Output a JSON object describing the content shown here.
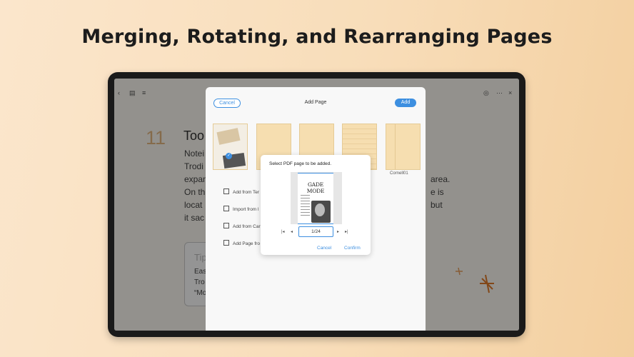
{
  "headline": "Merging, Rotating, and Rearranging Pages",
  "notebook": {
    "page_number": "11",
    "title": "Too",
    "lines": [
      "Notei",
      "Trodi",
      "expan",
      "On th",
      "locat",
      "it sac"
    ],
    "right_fragments": [
      "area.",
      "e is",
      "but"
    ],
    "tips_label": "Tip",
    "tips_lines": [
      "Eas",
      "Tro",
      "“Mo"
    ]
  },
  "add_page": {
    "cancel_label": "Cancel",
    "title": "Add Page",
    "add_label": "Add",
    "thumbnail_label": "Cornell01",
    "options": [
      "Add from Ter",
      "Import from l",
      "Add from Car",
      "Add Page fro"
    ]
  },
  "dialog": {
    "title": "Select PDF page to be added.",
    "page_indicator": "1/24",
    "magazine_title": "GADE MODE",
    "cancel_label": "Cancel",
    "confirm_label": "Confirm"
  },
  "colors": {
    "accent": "#3d8fe0",
    "paper": "#f6deb0",
    "page_number": "#e5b882"
  },
  "icons": [
    "back-icon",
    "sidebar-icon",
    "grid-icon",
    "settings-icon",
    "more-icon",
    "close-icon",
    "first-page-icon",
    "prev-page-icon",
    "next-page-icon",
    "last-page-icon",
    "template-icon",
    "import-icon",
    "camera-icon",
    "page-icon",
    "check-icon"
  ]
}
